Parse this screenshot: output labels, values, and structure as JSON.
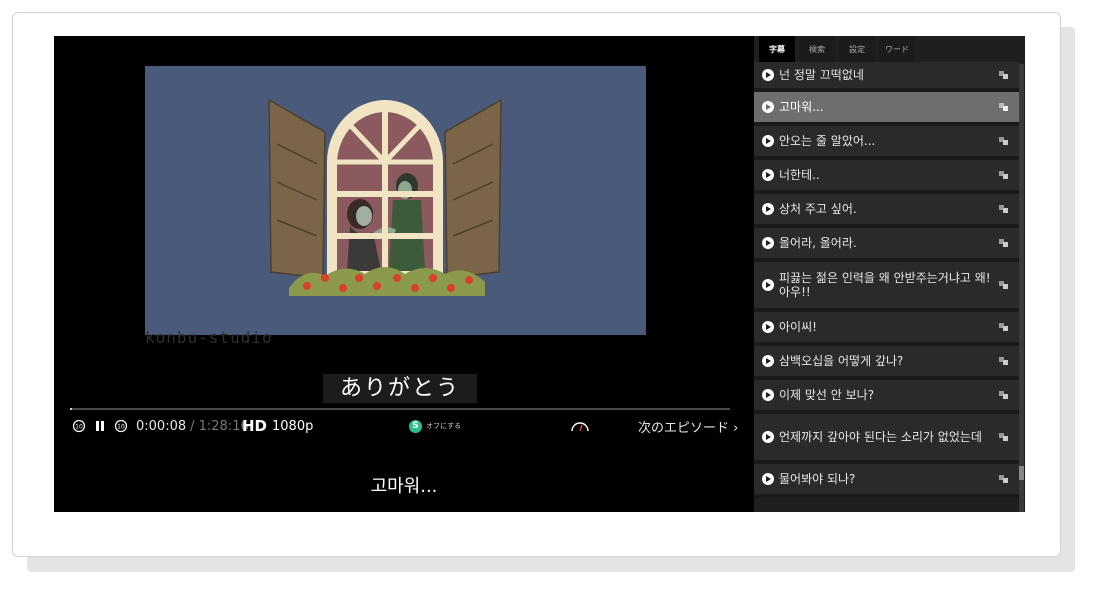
{
  "player": {
    "watermark": "konbu-studio",
    "jp_subtitle": "ありがとう",
    "ko_subtitle": "고마워...",
    "progress_fraction": 0.001,
    "controls": {
      "current_time": "0:00:08",
      "total_time": "/ 1:28:16",
      "hd_label": "HD",
      "resolution": "1080p",
      "subtitle_badge": "S",
      "subtitle_toggle_label": "オフにする",
      "next_episode": "次のエピソード ›"
    }
  },
  "sidebar": {
    "tabs": [
      "字幕",
      "検索",
      "設定",
      "ワード"
    ],
    "active_tab": 0,
    "items": [
      {
        "text": "넌 정말 끄떡없네",
        "active": false
      },
      {
        "text": "고마워...",
        "active": true
      },
      {
        "text": "안오는 줄 알았어...",
        "active": false
      },
      {
        "text": "너한테..",
        "active": false
      },
      {
        "text": "상처 주고 싶어.",
        "active": false
      },
      {
        "text": "올어라, 올어라.",
        "active": false
      },
      {
        "text": "피끓는 젊은 인력을 왜 안받주는거냐고 왜! 아우!!",
        "active": false
      },
      {
        "text": "아이씨!",
        "active": false
      },
      {
        "text": "삼백오십을 어떻게 갚나?",
        "active": false
      },
      {
        "text": "이제 맞선 안 보나?",
        "active": false
      },
      {
        "text": "언제까지 갚아야 된다는 소리가 없었는데",
        "active": false
      },
      {
        "text": "물어봐야 되나?",
        "active": false
      }
    ]
  },
  "colors": {
    "video_background": "#4a5a7b",
    "shutter": "#7a6548",
    "window_frame": "#f0e4c2",
    "window_glass": "#8a5a5f",
    "active_item": "#6e6e6e",
    "subtitle_badge": "#2fbf8f"
  }
}
